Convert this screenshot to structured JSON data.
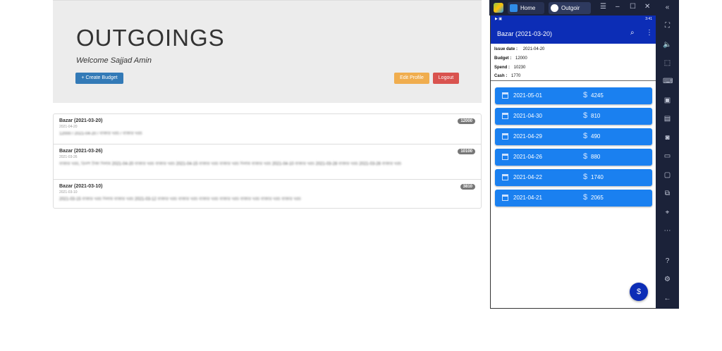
{
  "web": {
    "title": "OUTGOINGS",
    "welcome": "Welcome Sajjad Amin",
    "buttons": {
      "create": "+ Create Budget",
      "edit": "Edit Profile",
      "logout": "Logout"
    },
    "budgets": [
      {
        "title": "Bazar (2021-03-20)",
        "date": "2021-04-20",
        "amount": "12000",
        "blur": "12000 / 2021-04-20 / বাজার খরচ / বাজার খরচ"
      },
      {
        "title": "Bazar (2021-03-26)",
        "date": "2021-03-26",
        "amount": "10100",
        "blur": "বাজার খরচ, তিনশ টাকা দিলাম 2021-04-20 বাজার খরচ বাজার খরচ 2021-04-15 বাজার খরচ বাজার খরচ দিলাম বাজার খরচ 2021-04-10 বাজার খরচ 2021-03-28 বাজার খরচ 2021-03-26 বাজার খরচ"
      },
      {
        "title": "Bazar (2021-03-10)",
        "date": "2021-03-10",
        "amount": "3810",
        "blur": "2021-03-15 বাজার খরচ দিলাম বাজার খরচ 2021-03-12 বাজার খরচ বাজার খরচ বাজার খরচ বাজার খরচ বাজার খরচ বাজার খরচ বাজার খরচ"
      }
    ]
  },
  "emulator": {
    "tabs": {
      "home": "Home",
      "outgoings": "Outgoir"
    },
    "status_time": "3:41",
    "appbar_title": "Bazar (2021-03-20)",
    "info": {
      "issue_label": "Issue date :",
      "issue_value": "2021-04-20",
      "budget_label": "Budget :",
      "budget_value": "12000",
      "spend_label": "Spend :",
      "spend_value": "10230",
      "cash_label": "Cash :",
      "cash_value": "1770"
    },
    "entries": [
      {
        "date": "2021-05-01",
        "amount": "4245"
      },
      {
        "date": "2021-04-30",
        "amount": "810"
      },
      {
        "date": "2021-04-29",
        "amount": "490"
      },
      {
        "date": "2021-04-26",
        "amount": "880"
      },
      {
        "date": "2021-04-22",
        "amount": "1740"
      },
      {
        "date": "2021-04-21",
        "amount": "2065"
      }
    ],
    "fab_label": "$"
  },
  "colors": {
    "primary": "#0c2db6",
    "entry": "#1a80f0",
    "emulator_chrome": "#1b2239"
  }
}
